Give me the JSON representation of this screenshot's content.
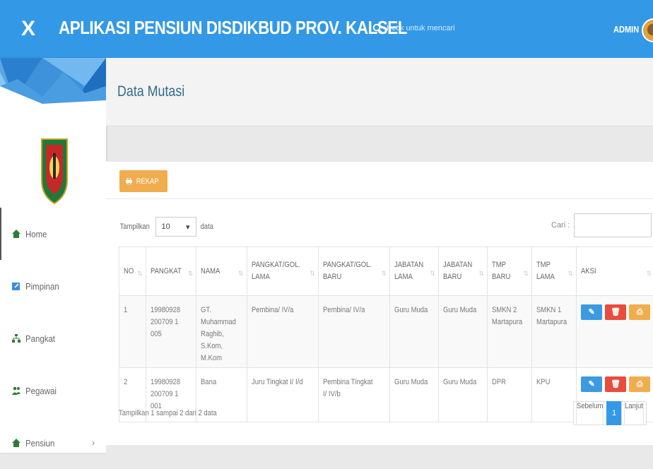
{
  "header": {
    "close_symbol": "X",
    "app_title": "APLIKASI PENSIUN DISDIKBUD PROV. KALSEL",
    "search_placeholder": "Ketik untuk mencari",
    "user_label": "ADMIN",
    "color": "#3399e6"
  },
  "sidebar": {
    "items": [
      {
        "label": "Home",
        "icon": "home-icon"
      },
      {
        "label": "Pimpinan",
        "icon": "edit-icon"
      },
      {
        "label": "Pangkat",
        "icon": "sitemap-icon"
      },
      {
        "label": "Pegawai",
        "icon": "users-icon"
      },
      {
        "label": "Pensiun",
        "icon": "home-icon",
        "chevron": "›"
      }
    ]
  },
  "page": {
    "title": "Data Mutasi",
    "rekap_label": "REKAP",
    "length": {
      "prefix": "Tampilkan",
      "value": "10",
      "suffix": "data"
    },
    "filter_label": "Cari :",
    "table": {
      "headers": [
        "NO",
        "PANGKAT",
        "NAMA",
        "PANGKAT/GOL. LAMA",
        "PANGKAT/GOL. BARU",
        "JABATAN LAMA",
        "JABATAN BARU",
        "TMP BARU",
        "TMP LAMA",
        "AKSI"
      ],
      "rows": [
        {
          "no": "1",
          "pangkat": [
            "19980928",
            "200709 1 005"
          ],
          "nama": [
            "GT. Muhammad Raghib,",
            "S.Kom, M.Kom"
          ],
          "gol_lama": "Pembina/ IV/a",
          "gol_baru": "Pembina/ IV/a",
          "jab_lama": "Guru Muda",
          "jab_baru": "Guru Muda",
          "tmp_baru": [
            "SMKN 2",
            "Martapura"
          ],
          "tmp_lama": [
            "SMKN 1",
            "Martapura"
          ]
        },
        {
          "no": "2",
          "pangkat": [
            "19980928",
            "200709 1 001"
          ],
          "nama": [
            "Bana",
            ""
          ],
          "gol_lama": "Juru Tingkat I/ I/d",
          "gol_baru": "Pembina Tingkat I/ IV/b",
          "jab_lama": "Guru Muda",
          "jab_baru": "Guru Muda",
          "tmp_baru": [
            "DPR",
            ""
          ],
          "tmp_lama": [
            "KPU",
            ""
          ]
        }
      ]
    },
    "info": "Tampilkan 1 sampai 2 dari 2 data",
    "pager": {
      "prev": "Sebelum",
      "current": "1",
      "next": "Lanjut"
    }
  }
}
